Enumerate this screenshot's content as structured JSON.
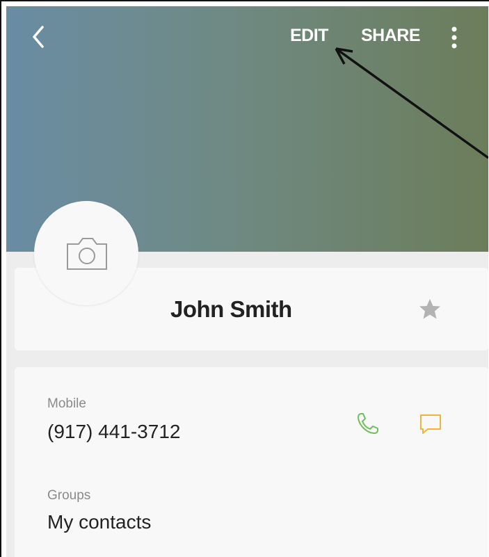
{
  "header": {
    "back_icon": "chevron-left-icon",
    "edit_label": "EDIT",
    "share_label": "SHARE",
    "more_icon": "more-vertical-icon"
  },
  "profile": {
    "avatar_icon": "camera-icon",
    "name": "John Smith",
    "favorite_icon": "star-icon"
  },
  "details": {
    "mobile_label": "Mobile",
    "mobile_value": "(917) 441-3712",
    "call_icon": "phone-icon",
    "message_icon": "message-icon",
    "groups_label": "Groups",
    "groups_value": "My contacts"
  },
  "colors": {
    "call_icon": "#6fbf5a",
    "message_icon": "#f0b43a",
    "star_icon": "#b3b3b3"
  }
}
